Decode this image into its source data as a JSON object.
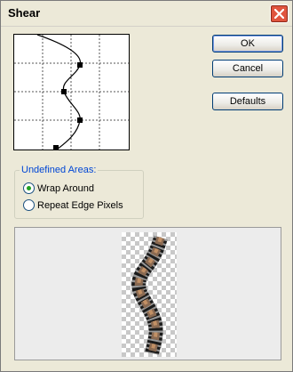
{
  "window": {
    "title": "Shear"
  },
  "buttons": {
    "ok": "OK",
    "cancel": "Cancel",
    "defaults": "Defaults"
  },
  "undefined_areas": {
    "label": "Undefined Areas:",
    "options": [
      {
        "label": "Wrap Around",
        "checked": true
      },
      {
        "label": "Repeat Edge Pixels",
        "checked": false
      }
    ]
  },
  "icons": {
    "close": "close-icon"
  }
}
